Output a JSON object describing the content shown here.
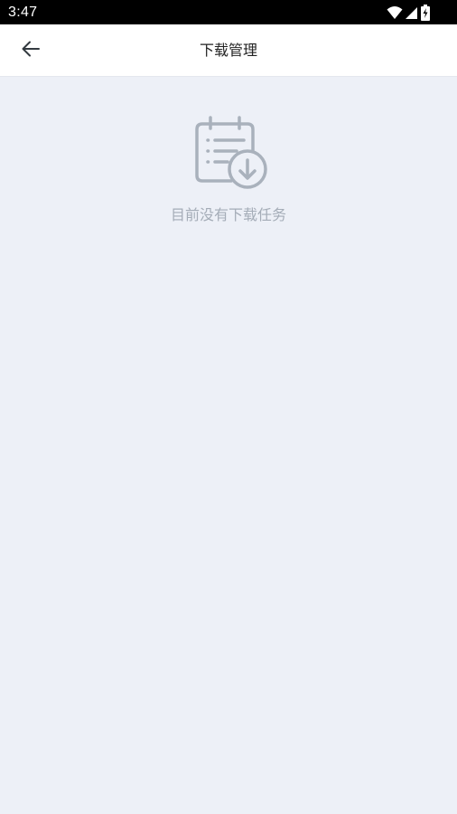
{
  "status_bar": {
    "time": "3:47",
    "icons": [
      "wifi-icon",
      "cellular-signal-icon",
      "battery-charging-icon"
    ]
  },
  "header": {
    "back_icon": "arrow-left-icon",
    "title": "下载管理"
  },
  "empty_state": {
    "icon": "clipboard-download-icon",
    "message": "目前没有下载任务"
  },
  "colors": {
    "status_bar_bg": "#000000",
    "app_bar_bg": "#FFFFFF",
    "page_bg": "#EDF0F7",
    "title_text": "#222222",
    "muted_text": "#A4ACB7"
  }
}
